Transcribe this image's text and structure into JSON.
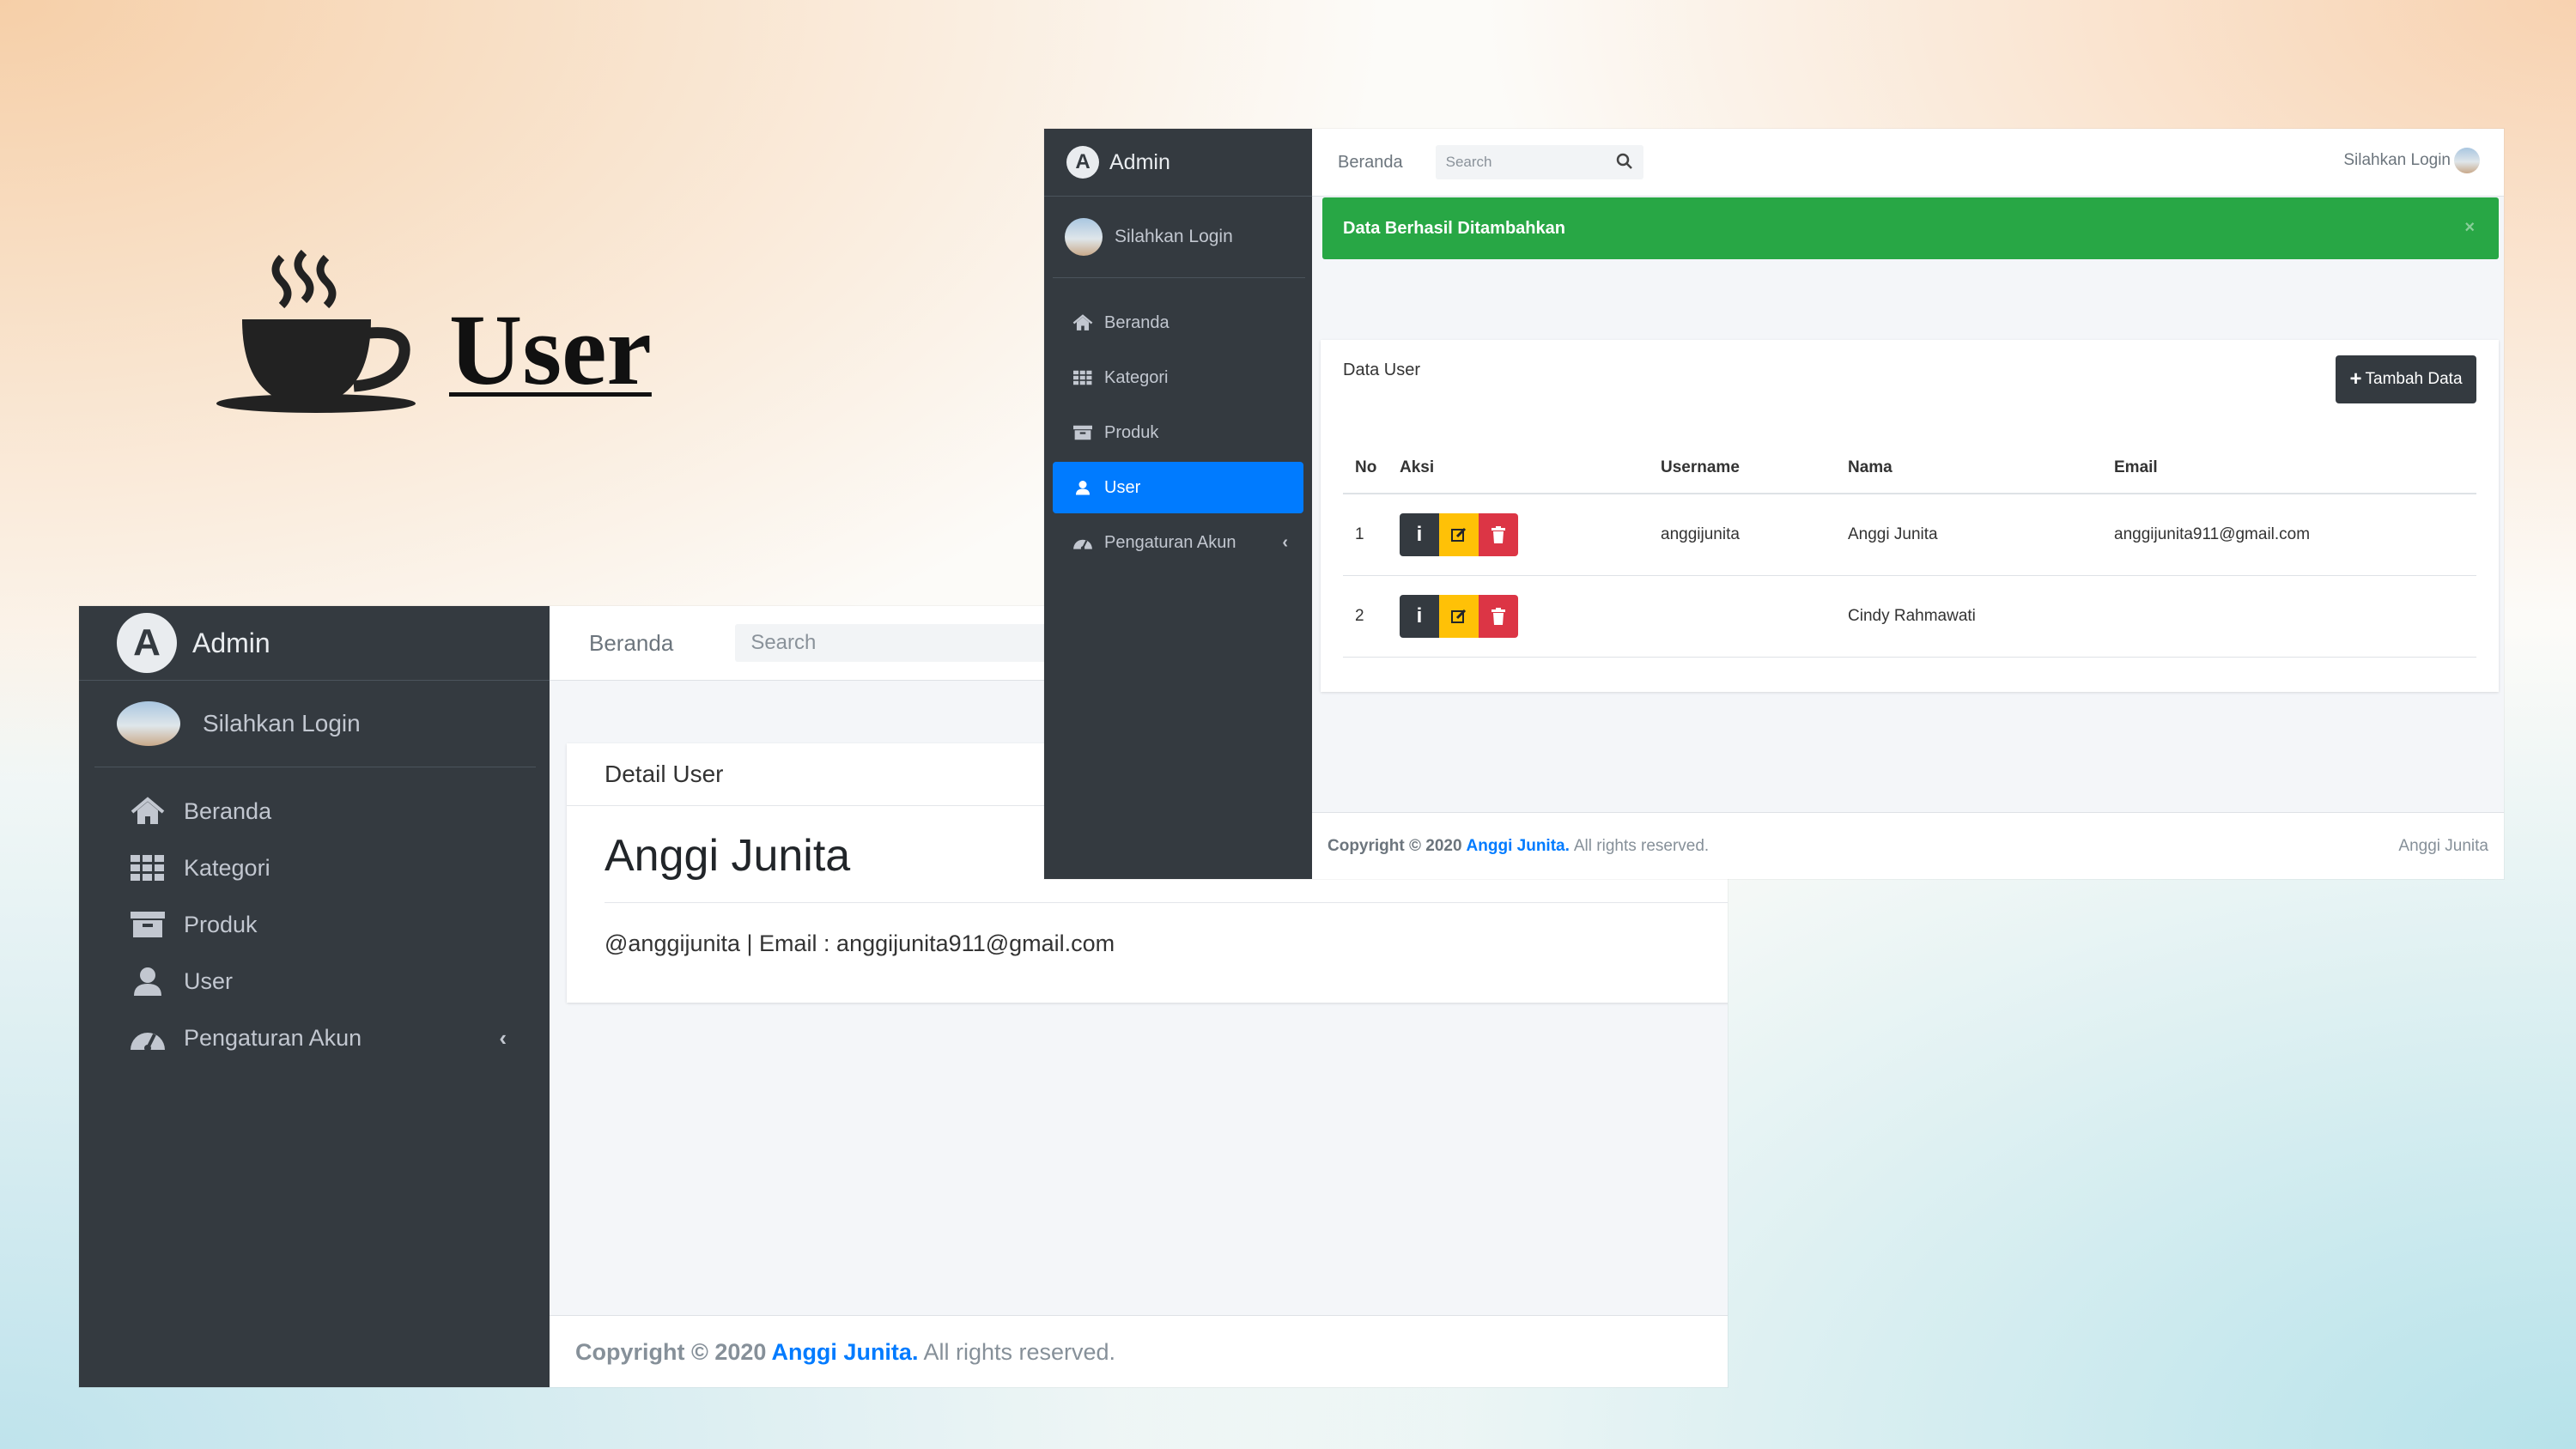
{
  "slide": {
    "title": "User"
  },
  "detail_screen": {
    "brand": "Admin",
    "user_panel": "Silahkan Login",
    "nav": [
      {
        "label": "Beranda",
        "icon": "home-icon"
      },
      {
        "label": "Kategori",
        "icon": "grid-icon"
      },
      {
        "label": "Produk",
        "icon": "archive-icon"
      },
      {
        "label": "User",
        "icon": "user-icon"
      },
      {
        "label": "Pengaturan Akun",
        "icon": "dashboard-icon"
      }
    ],
    "topbar": {
      "home_link": "Beranda",
      "search_placeholder": "Search"
    },
    "card_title": "Detail User",
    "detail": {
      "name": "Anggi Junita",
      "info": "@anggijunita | Email : anggijunita911@gmail.com"
    },
    "footer": {
      "prefix": "Copyright © 2020 ",
      "author": "Anggi Junita.",
      "suffix": " All rights reserved."
    }
  },
  "list_screen": {
    "brand": "Admin",
    "user_panel": "Silahkan Login",
    "nav": [
      {
        "label": "Beranda",
        "icon": "home-icon"
      },
      {
        "label": "Kategori",
        "icon": "grid-icon"
      },
      {
        "label": "Produk",
        "icon": "archive-icon"
      },
      {
        "label": "User",
        "icon": "user-icon",
        "active": true
      },
      {
        "label": "Pengaturan Akun",
        "icon": "dashboard-icon"
      }
    ],
    "topbar": {
      "home_link": "Beranda",
      "search_placeholder": "Search",
      "login_text": "Silahkan Login"
    },
    "alert": {
      "message": "Data Berhasil Ditambahkan",
      "close": "×"
    },
    "card_title": "Data User",
    "add_button": "Tambah Data",
    "table": {
      "headers": [
        "No",
        "Aksi",
        "Username",
        "Nama",
        "Email"
      ],
      "rows": [
        {
          "no": "1",
          "username": "anggijunita",
          "nama": "Anggi Junita",
          "email": "anggijunita911@gmail.com"
        },
        {
          "no": "2",
          "username": "",
          "nama": "Cindy Rahmawati",
          "email": ""
        }
      ]
    },
    "footer": {
      "prefix": "Copyright © 2020 ",
      "author": "Anggi Junita.",
      "suffix": " All rights reserved.",
      "right": "Anggi Junita"
    }
  },
  "colors": {
    "sidebar": "#343a40",
    "active": "#007bff",
    "success": "#28a745",
    "warning": "#ffc107",
    "danger": "#dc3545"
  }
}
